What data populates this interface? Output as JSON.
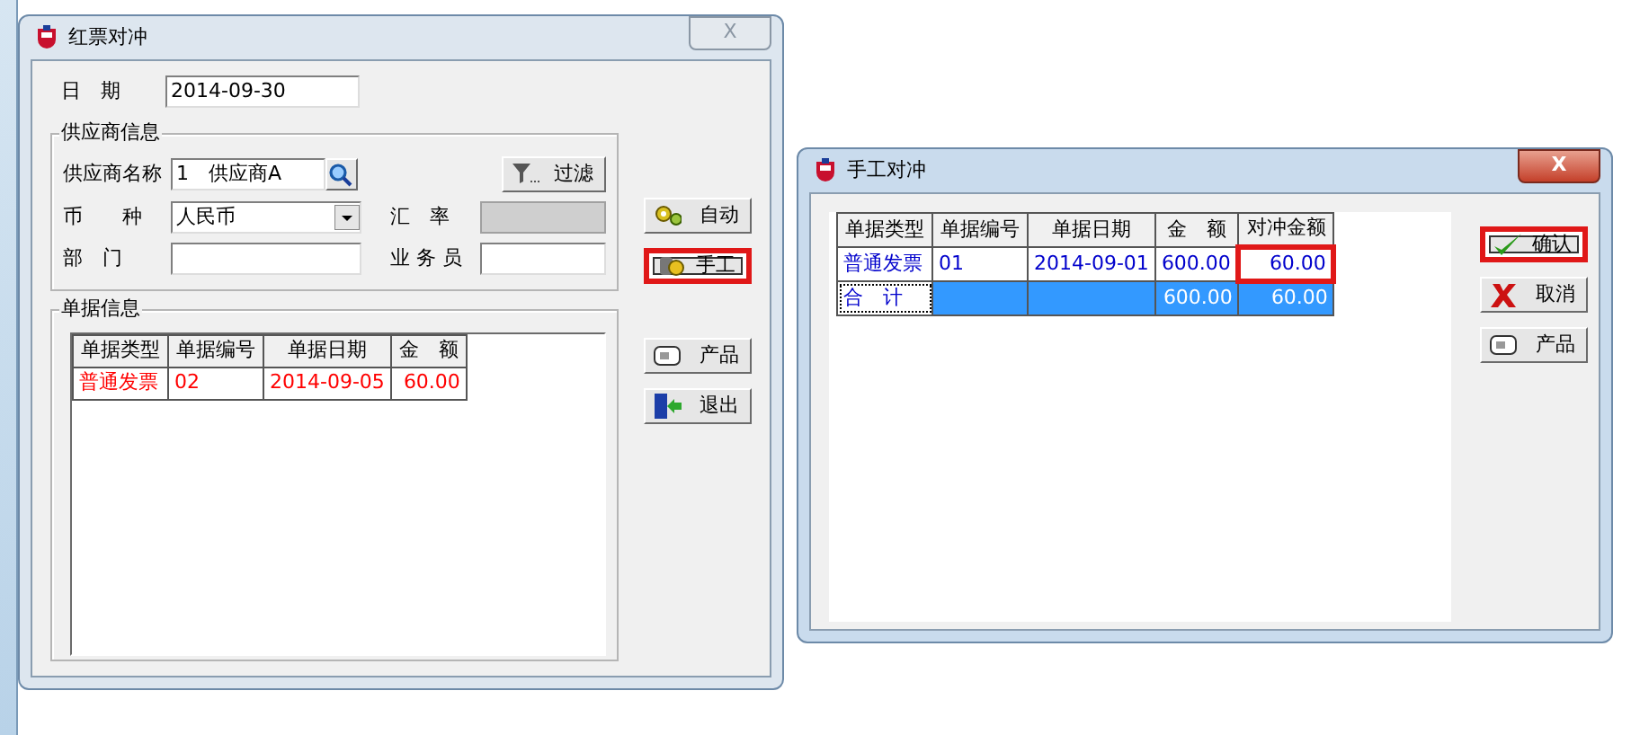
{
  "left_window": {
    "title": "红票对冲",
    "close_label": "X",
    "close_disabled": true,
    "date": {
      "label": "日　期",
      "value": "2014-09-30"
    },
    "supplier_group": {
      "title": "供应商信息",
      "fields": [
        {
          "kind": "lookup",
          "label": "供应商名称",
          "value": "1　供应商A",
          "disabled": false
        },
        {
          "kind": "select",
          "label": "币　　种",
          "value": "人民币",
          "disabled": false
        },
        {
          "kind": "text",
          "label": "汇　率",
          "disabled": true
        },
        {
          "kind": "text",
          "label": "部　门",
          "disabled": false
        },
        {
          "kind": "text",
          "label": "业 务 员",
          "disabled": false
        }
      ],
      "filter_button": {
        "label": "过滤"
      }
    },
    "documents_group": {
      "title": "单据信息",
      "columns": [
        "单据类型",
        "单据编号",
        "单据日期",
        "金　额"
      ],
      "rows": [
        {
          "cells": [
            "普通发票",
            "02",
            "2014-09-05",
            "60.00"
          ],
          "color": "#ff0000",
          "selected": false
        }
      ]
    },
    "buttons": [
      {
        "kind": "auto",
        "label": "自动",
        "highlighted": false
      },
      {
        "kind": "manual",
        "label": "手工",
        "highlighted": true
      },
      {
        "kind": "product",
        "label": "产品",
        "highlighted": false
      },
      {
        "kind": "exit",
        "label": "退出",
        "highlighted": false
      }
    ]
  },
  "right_window": {
    "title": "手工对冲",
    "close_label": "X",
    "close_disabled": false,
    "columns": [
      "单据类型",
      "单据编号",
      "单据日期",
      "金　额",
      "对冲金额"
    ],
    "rows": [
      {
        "cells": [
          "普通发票",
          "01",
          "2014-09-01",
          "600.00",
          "60.00"
        ],
        "color": "#0000cc",
        "selected": false,
        "highlighted_cells": [
          false,
          false,
          false,
          false,
          true
        ]
      },
      {
        "cells": [
          "合　计",
          "",
          "",
          "600.00",
          "60.00"
        ],
        "color": "#0000cc",
        "selected": true
      }
    ],
    "buttons": [
      {
        "kind": "confirm",
        "label": "确认",
        "highlighted": true
      },
      {
        "kind": "cancel",
        "label": "取消",
        "highlighted": false
      },
      {
        "kind": "product",
        "label": "产品",
        "highlighted": false
      }
    ]
  }
}
